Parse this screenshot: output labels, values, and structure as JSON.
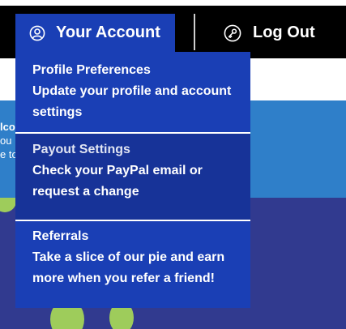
{
  "header": {
    "account_label": "Your Account",
    "logout_label": "Log Out"
  },
  "background": {
    "banner_lines": [
      "lco",
      "ou l",
      "e to"
    ]
  },
  "dropdown": {
    "items": [
      {
        "title": "Profile Preferences",
        "description": "Update your profile and account settings"
      },
      {
        "title": "Payout Settings",
        "description": "Check your PayPal email or request a change"
      },
      {
        "title": "Referrals",
        "description": "Take a slice of our pie and earn more when you refer a friend!"
      }
    ]
  },
  "colors": {
    "topbar": "#000000",
    "accent_blue": "#1a3fb5",
    "hover_blue": "#173398",
    "banner_blue": "#2f7fc9",
    "hero_indigo": "#313a8f",
    "blob_green": "#9ecc5b"
  },
  "icons": {
    "account": "user-circle-icon",
    "logout": "key-circle-icon"
  }
}
